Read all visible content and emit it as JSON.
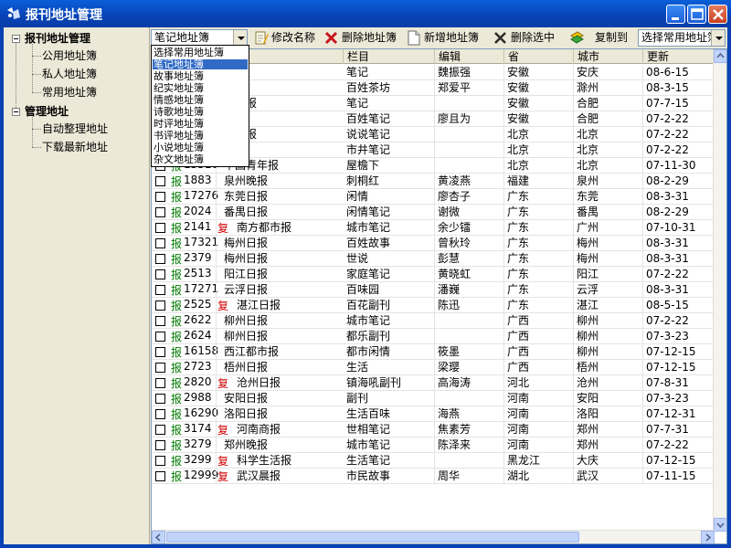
{
  "window": {
    "title": "报刊地址管理"
  },
  "tree": {
    "groups": [
      {
        "label": "报刊地址管理",
        "children": [
          "公用地址簿",
          "私人地址簿",
          "常用地址簿"
        ]
      },
      {
        "label": "管理地址",
        "children": [
          "自动整理地址",
          "下载最新地址"
        ]
      }
    ]
  },
  "toolbar": {
    "book_combo_value": "笔记地址簿",
    "rename_label": "修改名称",
    "delete_book_label": "删除地址簿",
    "new_book_label": "新增地址簿",
    "delete_selected_label": "删除选中",
    "copy_to_label": "复制到",
    "copy_target_value": "选择常用地址簿"
  },
  "dropdown": {
    "options": [
      "选择常用地址簿",
      "笔记地址簿",
      "故事地址簿",
      "纪实地址簿",
      "情感地址簿",
      "诗歌地址簿",
      "时评地址簿",
      "书评地址簿",
      "小说地址簿",
      "杂文地址簿"
    ],
    "selected_index": 1
  },
  "table": {
    "columns": [
      "",
      "栏目",
      "编辑",
      "省",
      "城市",
      "更新"
    ],
    "badge_bao": "报",
    "badge_fu": "复",
    "rows": [
      {
        "id": "",
        "name": "报",
        "fu": false,
        "column": "笔记",
        "editor": "魏振强",
        "prov": "安徽",
        "city": "安庆",
        "updated": "08-6-15"
      },
      {
        "id": "",
        "name": "刊",
        "fu": false,
        "column": "百姓茶坊",
        "editor": "郑爱平",
        "prov": "安徽",
        "city": "滁州",
        "updated": "08-3-15"
      },
      {
        "id": "",
        "name": "徽商报",
        "fu": false,
        "column": "笔记",
        "editor": "",
        "prov": "安徽",
        "city": "合肥",
        "updated": "07-7-15"
      },
      {
        "id": "",
        "name": "报",
        "fu": false,
        "column": "百姓笔记",
        "editor": "廖且为",
        "prov": "安徽",
        "city": "合肥",
        "updated": "07-2-22"
      },
      {
        "id": "",
        "name": "市晚报",
        "fu": false,
        "column": "说说笔记",
        "editor": "",
        "prov": "北京",
        "city": "北京",
        "updated": "07-2-22"
      },
      {
        "id": "",
        "name": "报",
        "fu": false,
        "column": "市井笔记",
        "editor": "",
        "prov": "北京",
        "city": "北京",
        "updated": "07-2-22"
      },
      {
        "id": "13316",
        "name": "中国青年报",
        "fu": false,
        "column": "屋檐下",
        "editor": "",
        "prov": "北京",
        "city": "北京",
        "updated": "07-11-30"
      },
      {
        "id": "1883",
        "name": "泉州晚报",
        "fu": false,
        "column": "刺桐红",
        "editor": "黄凌燕",
        "prov": "福建",
        "city": "泉州",
        "updated": "08-2-29"
      },
      {
        "id": "17276",
        "name": "东莞日报",
        "fu": false,
        "column": "闲情",
        "editor": "廖杏子",
        "prov": "广东",
        "city": "东莞",
        "updated": "08-3-31"
      },
      {
        "id": "2024",
        "name": "番禺日报",
        "fu": false,
        "column": "闲情笔记",
        "editor": "谢微",
        "prov": "广东",
        "city": "番禺",
        "updated": "08-2-29"
      },
      {
        "id": "2141",
        "name": "南方都市报",
        "fu": true,
        "column": "城市笔记",
        "editor": "余少镭",
        "prov": "广东",
        "city": "广州",
        "updated": "07-10-31"
      },
      {
        "id": "17321",
        "name": "梅州日报",
        "fu": false,
        "column": "百姓故事",
        "editor": "曾秋玲",
        "prov": "广东",
        "city": "梅州",
        "updated": "08-3-31"
      },
      {
        "id": "2379",
        "name": "梅州日报",
        "fu": false,
        "column": "世说",
        "editor": "彭慧",
        "prov": "广东",
        "city": "梅州",
        "updated": "08-3-31"
      },
      {
        "id": "2513",
        "name": "阳江日报",
        "fu": false,
        "column": "家庭笔记",
        "editor": "黄晓虹",
        "prov": "广东",
        "city": "阳江",
        "updated": "07-2-22"
      },
      {
        "id": "17271",
        "name": "云浮日报",
        "fu": false,
        "column": "百味园",
        "editor": "潘巍",
        "prov": "广东",
        "city": "云浮",
        "updated": "08-3-31"
      },
      {
        "id": "2525",
        "name": "湛江日报",
        "fu": true,
        "column": "百花副刊",
        "editor": "陈迅",
        "prov": "广东",
        "city": "湛江",
        "updated": "08-5-15"
      },
      {
        "id": "2622",
        "name": "柳州日报",
        "fu": false,
        "column": "城市笔记",
        "editor": "",
        "prov": "广西",
        "city": "柳州",
        "updated": "07-2-22"
      },
      {
        "id": "2624",
        "name": "柳州日报",
        "fu": false,
        "column": "都乐副刊",
        "editor": "",
        "prov": "广西",
        "city": "柳州",
        "updated": "07-3-23"
      },
      {
        "id": "16158",
        "name": "西江都市报",
        "fu": false,
        "column": "都市闲情",
        "editor": "筱墨",
        "prov": "广西",
        "city": "柳州",
        "updated": "07-12-15"
      },
      {
        "id": "2723",
        "name": "梧州日报",
        "fu": false,
        "column": "生活",
        "editor": "梁璎",
        "prov": "广西",
        "city": "梧州",
        "updated": "07-12-15"
      },
      {
        "id": "2820",
        "name": "沧州日报",
        "fu": true,
        "column": "镇海吼副刊",
        "editor": "高海涛",
        "prov": "河北",
        "city": "沧州",
        "updated": "07-8-31"
      },
      {
        "id": "2988",
        "name": "安阳日报",
        "fu": false,
        "column": "副刊",
        "editor": "",
        "prov": "河南",
        "city": "安阳",
        "updated": "07-3-23"
      },
      {
        "id": "16290",
        "name": "洛阳日报",
        "fu": false,
        "column": "生活百味",
        "editor": "海燕",
        "prov": "河南",
        "city": "洛阳",
        "updated": "07-12-31"
      },
      {
        "id": "3174",
        "name": "河南商报",
        "fu": true,
        "column": "世相笔记",
        "editor": "焦素芳",
        "prov": "河南",
        "city": "郑州",
        "updated": "07-7-31"
      },
      {
        "id": "3279",
        "name": "郑州晚报",
        "fu": false,
        "column": "城市笔记",
        "editor": "陈泽来",
        "prov": "河南",
        "city": "郑州",
        "updated": "07-2-22"
      },
      {
        "id": "3299",
        "name": "科学生活报",
        "fu": true,
        "column": "生活笔记",
        "editor": "",
        "prov": "黑龙江",
        "city": "大庆",
        "updated": "07-12-15"
      },
      {
        "id": "12999",
        "name": "武汉晨报",
        "fu": true,
        "column": "市民故事",
        "editor": "周华",
        "prov": "湖北",
        "city": "武汉",
        "updated": "07-11-15"
      }
    ]
  }
}
